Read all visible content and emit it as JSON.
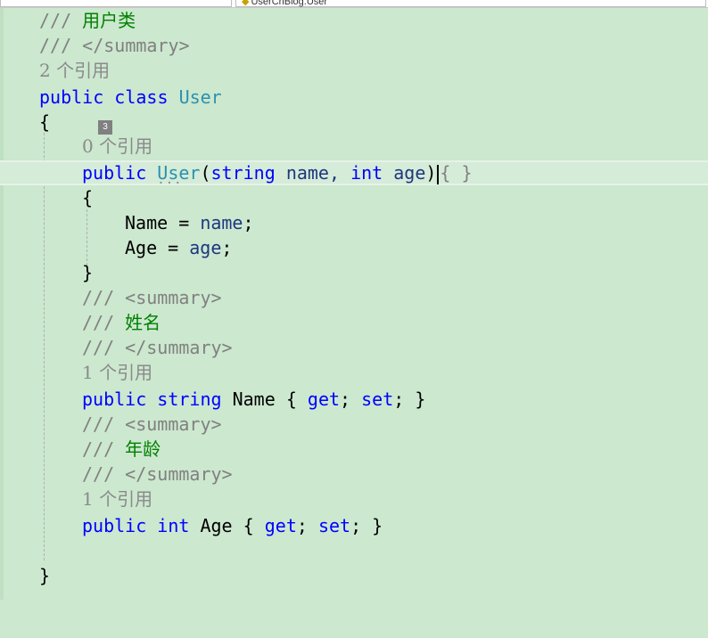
{
  "tabs": {
    "file_label": "UserCnBlog.User"
  },
  "code": {
    "l1_comment": "///",
    "l1_text": "用户类",
    "l2_comment": "/// </summary>",
    "l3_refs": "2 个引用",
    "l4_kw1": "public",
    "l4_kw2": "class",
    "l4_type": "User",
    "l5_brace": "{",
    "badge": "3",
    "l6_refs": "0 个引用",
    "l7_kw": "public",
    "l7_type": "User",
    "l7_open": "(",
    "l7_kw2": "string",
    "l7_p1": "name,",
    "l7_kw3": "int",
    "l7_p2": "age",
    "l7_close": ")",
    "l7_collapsed": "{ }",
    "l8_brace": "{",
    "l9_left": "Name",
    "l9_eq": "=",
    "l9_right": "name",
    "l9_semi": ";",
    "l10_left": "Age",
    "l10_eq": "=",
    "l10_right": "age",
    "l10_semi": ";",
    "l11_brace": "}",
    "l12_comment": "/// <summary>",
    "l13_comment": "///",
    "l13_text": "姓名",
    "l14_comment": "/// </summary>",
    "l15_refs": "1 个引用",
    "l16_kw1": "public",
    "l16_kw2": "string",
    "l16_name": "Name",
    "l16_ob": "{",
    "l16_get": "get",
    "l16_s1": ";",
    "l16_set": "set",
    "l16_s2": ";",
    "l16_cb": "}",
    "l17_comment": "/// <summary>",
    "l18_comment": "///",
    "l18_text": "年龄",
    "l19_comment": "/// </summary>",
    "l20_refs": "1 个引用",
    "l21_kw1": "public",
    "l21_kw2": "int",
    "l21_name": "Age",
    "l21_ob": "{",
    "l21_get": "get",
    "l21_s1": ";",
    "l21_set": "set",
    "l21_s2": ";",
    "l21_cb": "}",
    "l23_brace": "}"
  },
  "colors": {
    "background": "#cce8cf",
    "keyword": "#0000ff",
    "type": "#2b91af",
    "comment": "#808080",
    "xml_text": "#008000"
  }
}
